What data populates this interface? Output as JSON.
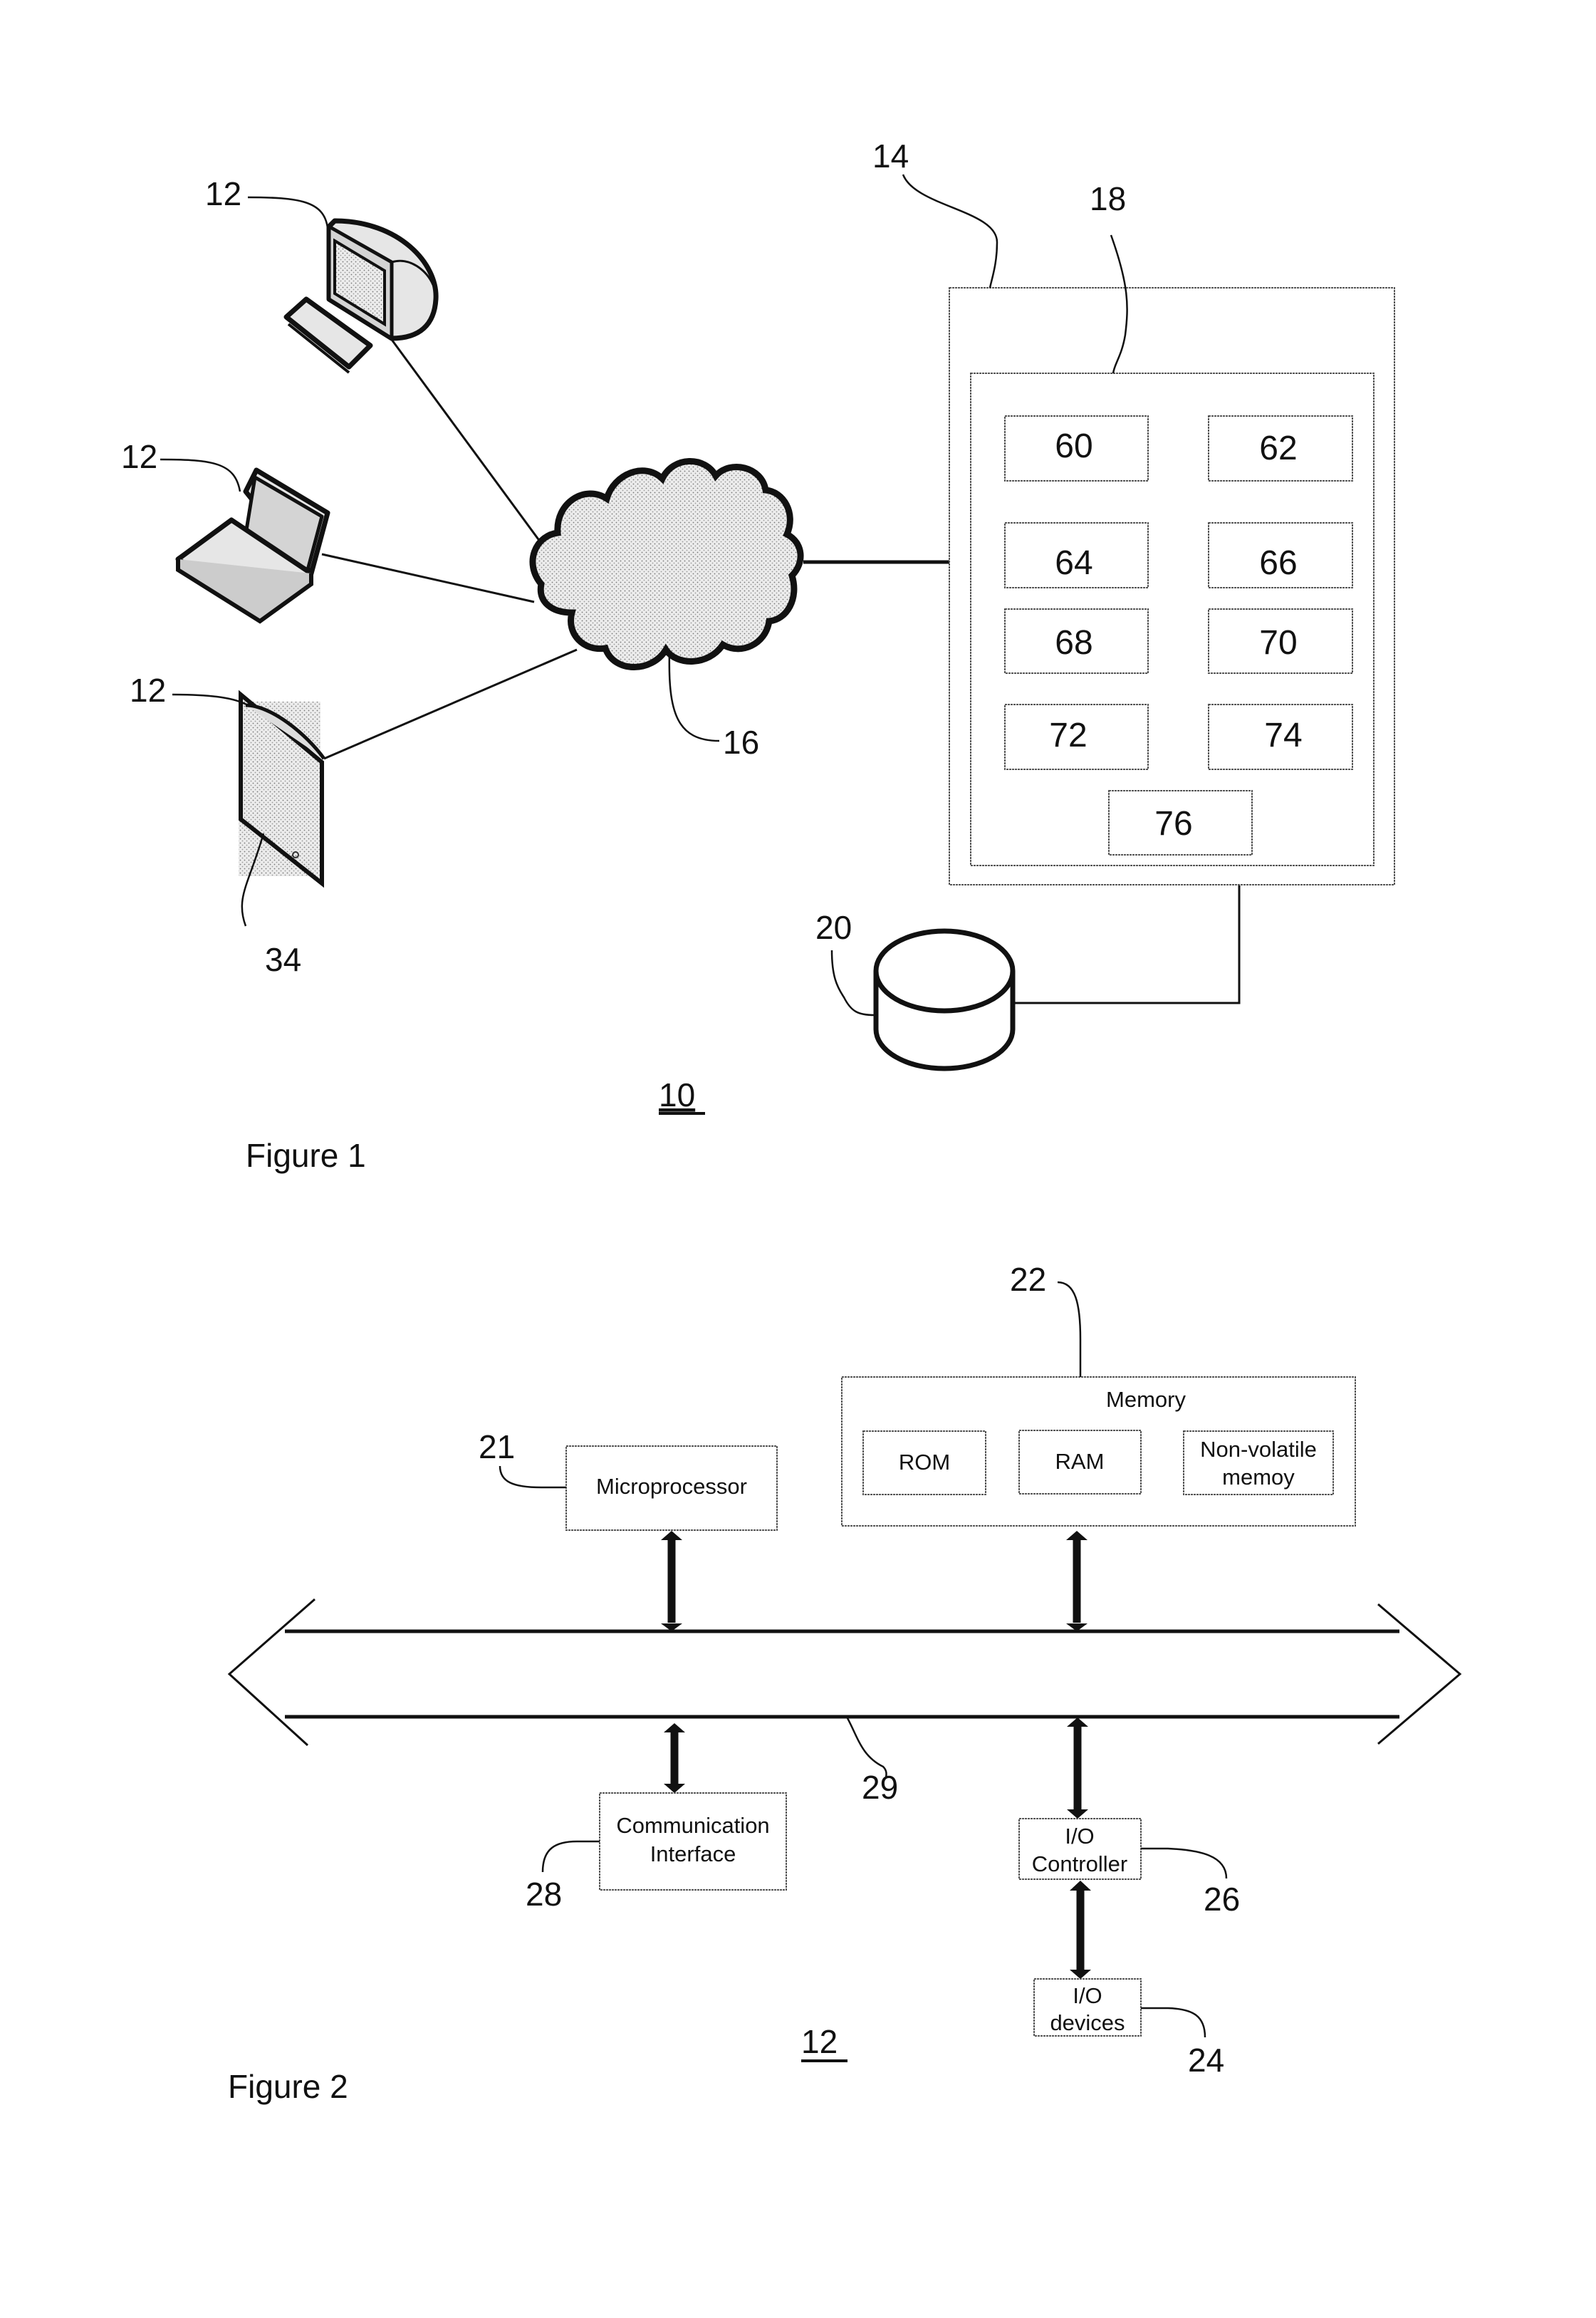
{
  "figure1": {
    "caption": "Figure 1",
    "system_ref": "10",
    "devices": [
      {
        "type": "desktop-computer",
        "ref": "12"
      },
      {
        "type": "laptop-computer",
        "ref": "12"
      },
      {
        "type": "mobile-device",
        "ref": "12",
        "screen_ref": "34"
      }
    ],
    "network": {
      "type": "cloud",
      "ref": "16"
    },
    "server": {
      "ref": "14",
      "module_container_ref": "18",
      "modules": [
        "60",
        "62",
        "64",
        "66",
        "68",
        "70",
        "72",
        "74",
        "76"
      ]
    },
    "database": {
      "type": "cylinder",
      "ref": "20"
    }
  },
  "figure2": {
    "caption": "Figure 2",
    "device_ref": "12",
    "bus": {
      "ref": "29"
    },
    "microprocessor": {
      "label": "Microprocessor",
      "ref": "21"
    },
    "memory": {
      "label": "Memory",
      "ref": "22",
      "parts": [
        "ROM",
        "RAM",
        "Non-volatile",
        "memoy"
      ]
    },
    "communication_interface": {
      "line1": "Communication",
      "line2": "Interface",
      "ref": "28"
    },
    "io_controller": {
      "line1": "I/O",
      "line2": "Controller",
      "ref": "26"
    },
    "io_devices": {
      "line1": "I/O",
      "line2": "devices",
      "ref": "24"
    }
  }
}
